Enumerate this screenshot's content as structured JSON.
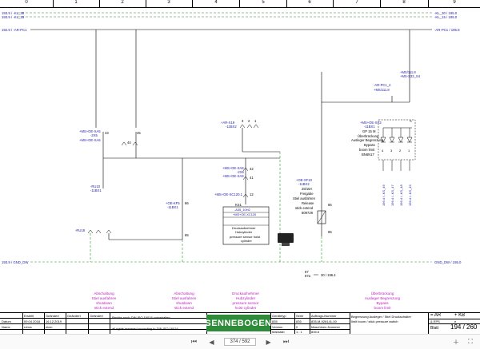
{
  "columns": [
    "0",
    "1",
    "2",
    "3",
    "4",
    "5",
    "6",
    "7",
    "8",
    "9"
  ],
  "signals": {
    "top_left_1": "193.9 / -KL_30",
    "top_left_2": "193.9 / -KL_15",
    "top_right_1": "-KL_30 / 195.0",
    "top_right_2": "-KL_15 / 195.0",
    "pc1_left": "192.9 / -AR-PC1",
    "pc1_right": "-AR-PC1 / 195.8",
    "gnd_left": "193.9 / GND_DW",
    "gnd_right": "GND_DW / 195.0",
    "ms111": "+MS/111.8",
    "ms111_s4": "+MS-S33_S4",
    "ms_pc1": "-AR-PC1_2",
    "ms_pc1b": "+MS/111.8",
    "xa5": "+MS+OE-XA5",
    "xa5_2": "-2X5",
    "xa6": "+MS+OE-XA6",
    "pin43": "43",
    "pin45": "45",
    "pin44": "44",
    "pin3": "3",
    "pin2": "2",
    "pin1": "1",
    "x19": "+AR-X19",
    "x19b": "-11BX2",
    "ru10": "-RU10",
    "ru10b": "-11BX1",
    "ru18": "-RU18",
    "oekt5": "+OE-KF5",
    "oekt5b": "-11BX1",
    "pin86a": "86",
    "pin85a": "85",
    "xa8": "+MS+OE-XA8",
    "xa8b": "-2X5",
    "xa9": "+MS+OE-XA9",
    "pin42": "42",
    "pin41": "41",
    "xc120": "+MS+OE-XC120.1",
    "pin12": "12",
    "ks1": "KS1",
    "ks1_wire1": "-A35_10H2",
    "ks1_wire2": "+MS+OE-XC120",
    "sensor_de": "Druckaufnehmer",
    "sensor_de2": "Hubzylinder",
    "sensor_en": "pressure sensor hoist",
    "sensor_en2": "cylinder",
    "xf10": "+OE-XF10",
    "xf10b": "-11BX2",
    "rel_1": "28/16A",
    "rel_2": "Freigabe",
    "rel_3": "Stiel ausfahren",
    "rel_4": "Release",
    "rel_5": "stick extend",
    "rel_6": "809729",
    "pin86": "86",
    "pin85": "85",
    "pin87": "87",
    "pin87a": "87a",
    "relay_ref": "30 / 196.4",
    "xa3": "+MS+OE-XA3",
    "xa3b": "-11BX1",
    "gp15": "GP 15 M",
    "ubr1": "Überbrückung",
    "ubr2": "Ausleger Begrenzung",
    "ubr3": "Bypass",
    "ubr4": "boom limit",
    "ubr5": "BN6N17",
    "diode_pins": [
      "4",
      "3",
      "2",
      "1"
    ],
    "vert_labels": [
      "196.4 / -KS_46",
      "196.4 / -KS_47",
      "196.4 / -KS_48",
      "196.4 / -KS_49"
    ],
    "captions": [
      {
        "l1": "Abschaltung",
        "l2": "Stiel ausfahren",
        "l3": "shutdown",
        "l4": "stick extend"
      },
      {
        "l1": "Abschaltung",
        "l2": "Stiel ausfahren",
        "l3": "shutdown",
        "l4": "stick extend"
      },
      {
        "l1": "Druckaufnehmer",
        "l2": "Hubzylinder",
        "l3": "pressure sensor",
        "l4": "hoist cylinder"
      },
      {
        "l1": "Überbrückung",
        "l2": "Ausleger Begrenzung",
        "l3": "Bypass",
        "l4": "boom limit"
      }
    ]
  },
  "title_block": {
    "erstellt": "Erstellt",
    "geaendert1": "Geändert",
    "geaendert2": "Geändert",
    "geaendert3": "Geändert",
    "datum_label": "Datum",
    "datum1": "09.04.2018",
    "datum2": "16.12.2019",
    "name_label": "Name",
    "name1": "rohcs",
    "name2": "eicm",
    "rights_de": "Rechte nach DIN ISO 16016 vorbehalten",
    "rights_en": "all rights reserved according to DIN ISO 16016",
    "logo": "SENNEBOGEN",
    "geraetetyp_label": "Gerätetyp",
    "geraetetyp": "835",
    "version_label": "Version",
    "version": "0",
    "massstab_label": "Maßstab",
    "massstab": "1 : 1",
    "serie_label": "Serie",
    "serie": "835",
    "serie_code": "835.6",
    "auftrag_label": "Auftrags-Nummer",
    "auftrag": "835-M-928141-00",
    "maschine_label": "Maschinen-Nummer",
    "desc_de": "Begrenzung Ausleger / Stiel Druckschalter",
    "desc_en": "limit boom / stick pressure switch",
    "ar_label": "= AR",
    "kb_label": "+ KB",
    "eps_label": "& EPS",
    "e_label": "e",
    "blatt_label": "Blatt",
    "blatt": "194 / 260"
  },
  "toolbar": {
    "page": "374 / 592"
  }
}
